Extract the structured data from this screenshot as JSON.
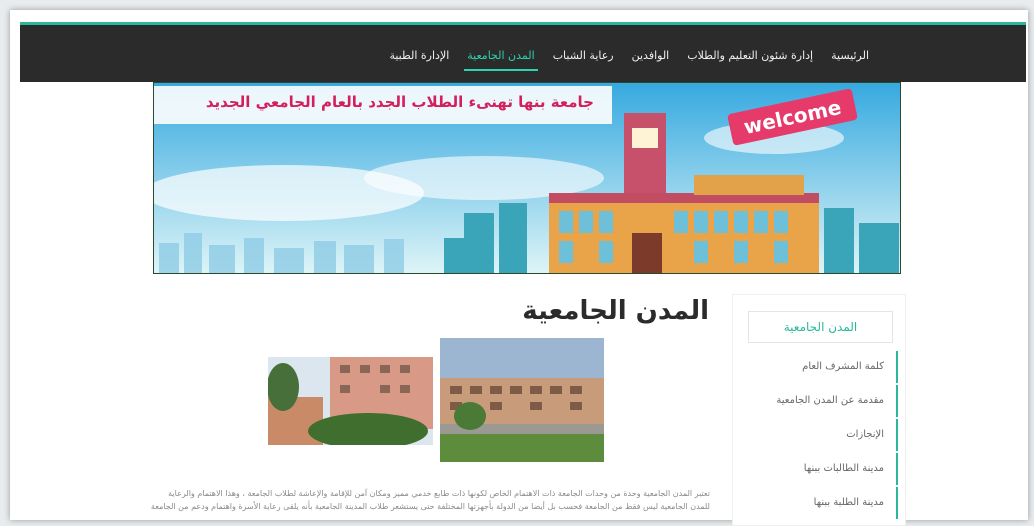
{
  "nav": {
    "items": [
      {
        "label": "الرئيسية"
      },
      {
        "label": "إدارة شئون التعليم والطلاب"
      },
      {
        "label": "الوافدين"
      },
      {
        "label": "رعاية الشباب"
      },
      {
        "label": "المدن الجامعية",
        "active": true
      },
      {
        "label": "الإدارة الطبية"
      }
    ]
  },
  "banner": {
    "headline": "جامعة بنها تهنىء الطلاب الجدد بالعام الجامعي الجديد",
    "welcome": "welcome"
  },
  "content": {
    "title": "المدن الجامعية",
    "paragraph": "تعتبر المدن الجامعية وحدة من وحدات الجامعة ذات الاهتمام الخاص لكونها ذات طابع خدمي مميز ومكان آمن للإقامة والإعاشة لطلاب الجامعة ، وهذا الاهتمام والرعاية للمدن الجامعية ليس فقط من الجامعة فحسب بل أيضا من الدولة بأجهزتها المختلفة حتى يستشعر طلاب المدينة الجامعية بأنه يلقى رعاية الأسرة واهتمام ودعم من الجامعة"
  },
  "sidebar": {
    "heading": "المدن الجامعية",
    "items": [
      {
        "label": "كلمة المشرف العام"
      },
      {
        "label": "مقدمة عن المدن الجامعية"
      },
      {
        "label": "الإنجازات"
      },
      {
        "label": "مدينة الطالبات ببنها"
      },
      {
        "label": "مدينة الطلبة ببنها"
      }
    ]
  },
  "colors": {
    "accent": "#2bb89a",
    "nav_bg": "#2b2b2b",
    "headline": "#e4104f"
  }
}
